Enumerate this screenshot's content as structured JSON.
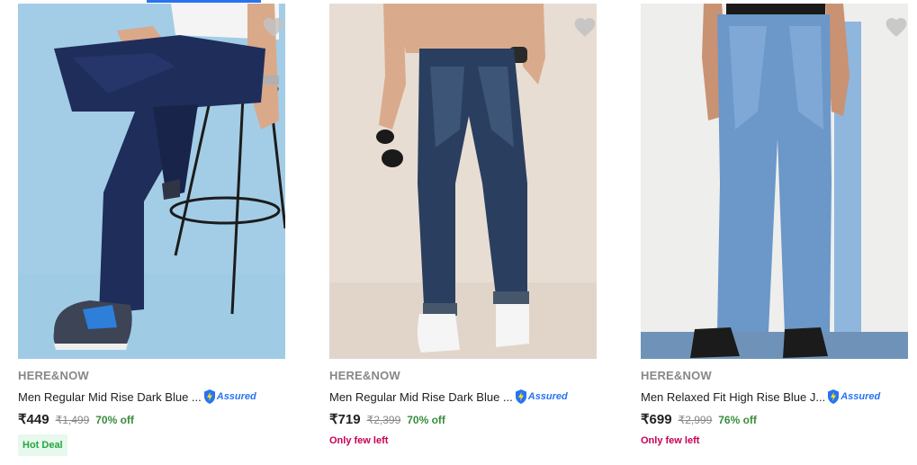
{
  "products": [
    {
      "brand": "HERE&NOW",
      "title": "Men Regular Mid Rise Dark Blue ...",
      "assured_label": "Assured",
      "price": "₹449",
      "mrp": "₹1,499",
      "discount": "70% off",
      "tag": "Hot Deal",
      "image_desc": "dark-blue-jeans-seated-model"
    },
    {
      "brand": "HERE&NOW",
      "title": "Men Regular Mid Rise Dark Blue ...",
      "assured_label": "Assured",
      "price": "₹719",
      "mrp": "₹2,399",
      "discount": "70% off",
      "stock_note": "Only few left",
      "image_desc": "dark-blue-jeans-standing-model"
    },
    {
      "brand": "HERE&NOW",
      "title": "Men Relaxed Fit High Rise Blue J...",
      "assured_label": "Assured",
      "price": "₹699",
      "mrp": "₹2,999",
      "discount": "76% off",
      "stock_note": "Only few left",
      "image_desc": "light-blue-jeans-standing-model"
    }
  ],
  "colors": {
    "accent": "#2874f0",
    "discount": "#388e3c",
    "stock_warning": "#c70055",
    "hot_deal_bg": "#e7f8ec",
    "wishlist_heart": "#c2c2c2"
  },
  "icons": [
    "heart-icon",
    "assured-badge-icon"
  ]
}
